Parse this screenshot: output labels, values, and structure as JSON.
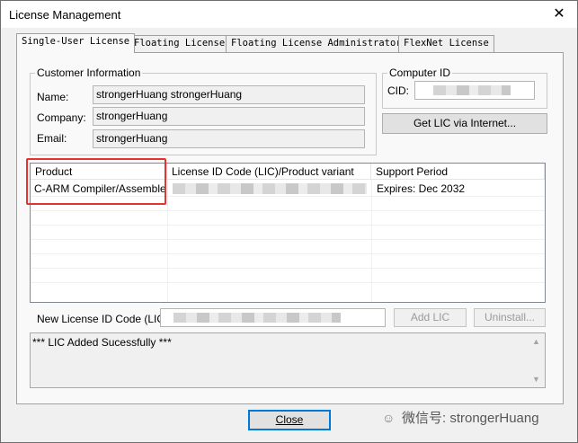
{
  "window": {
    "title": "License Management",
    "close_glyph": "✕"
  },
  "tabs": [
    {
      "label": "Single-User License",
      "active": true
    },
    {
      "label": "Floating License",
      "active": false
    },
    {
      "label": "Floating License Administrator",
      "active": false
    },
    {
      "label": "FlexNet License",
      "active": false
    }
  ],
  "customer_info": {
    "legend": "Customer Information",
    "name_label": "Name:",
    "name_value": "strongerHuang strongerHuang",
    "company_label": "Company:",
    "company_value": "strongerHuang",
    "email_label": "Email:",
    "email_value": "strongerHuang"
  },
  "computer_id": {
    "legend": "Computer ID",
    "cid_label": "CID:",
    "get_lic_button": "Get LIC via Internet..."
  },
  "license_table": {
    "columns": [
      "Product",
      "License ID Code (LIC)/Product variant",
      "Support Period"
    ],
    "rows": [
      {
        "product": "C-ARM Compiler/Assembler Kit",
        "lic": "",
        "support_period": "Expires: Dec 2032"
      }
    ]
  },
  "new_lic": {
    "label": "New License ID Code (LIC):",
    "add_button": "Add LIC",
    "uninstall_button": "Uninstall..."
  },
  "log": {
    "message": "*** LIC Added Sucessfully ***"
  },
  "footer": {
    "close_button": "Close"
  },
  "watermark": {
    "text": "微信号: strongerHuang"
  }
}
